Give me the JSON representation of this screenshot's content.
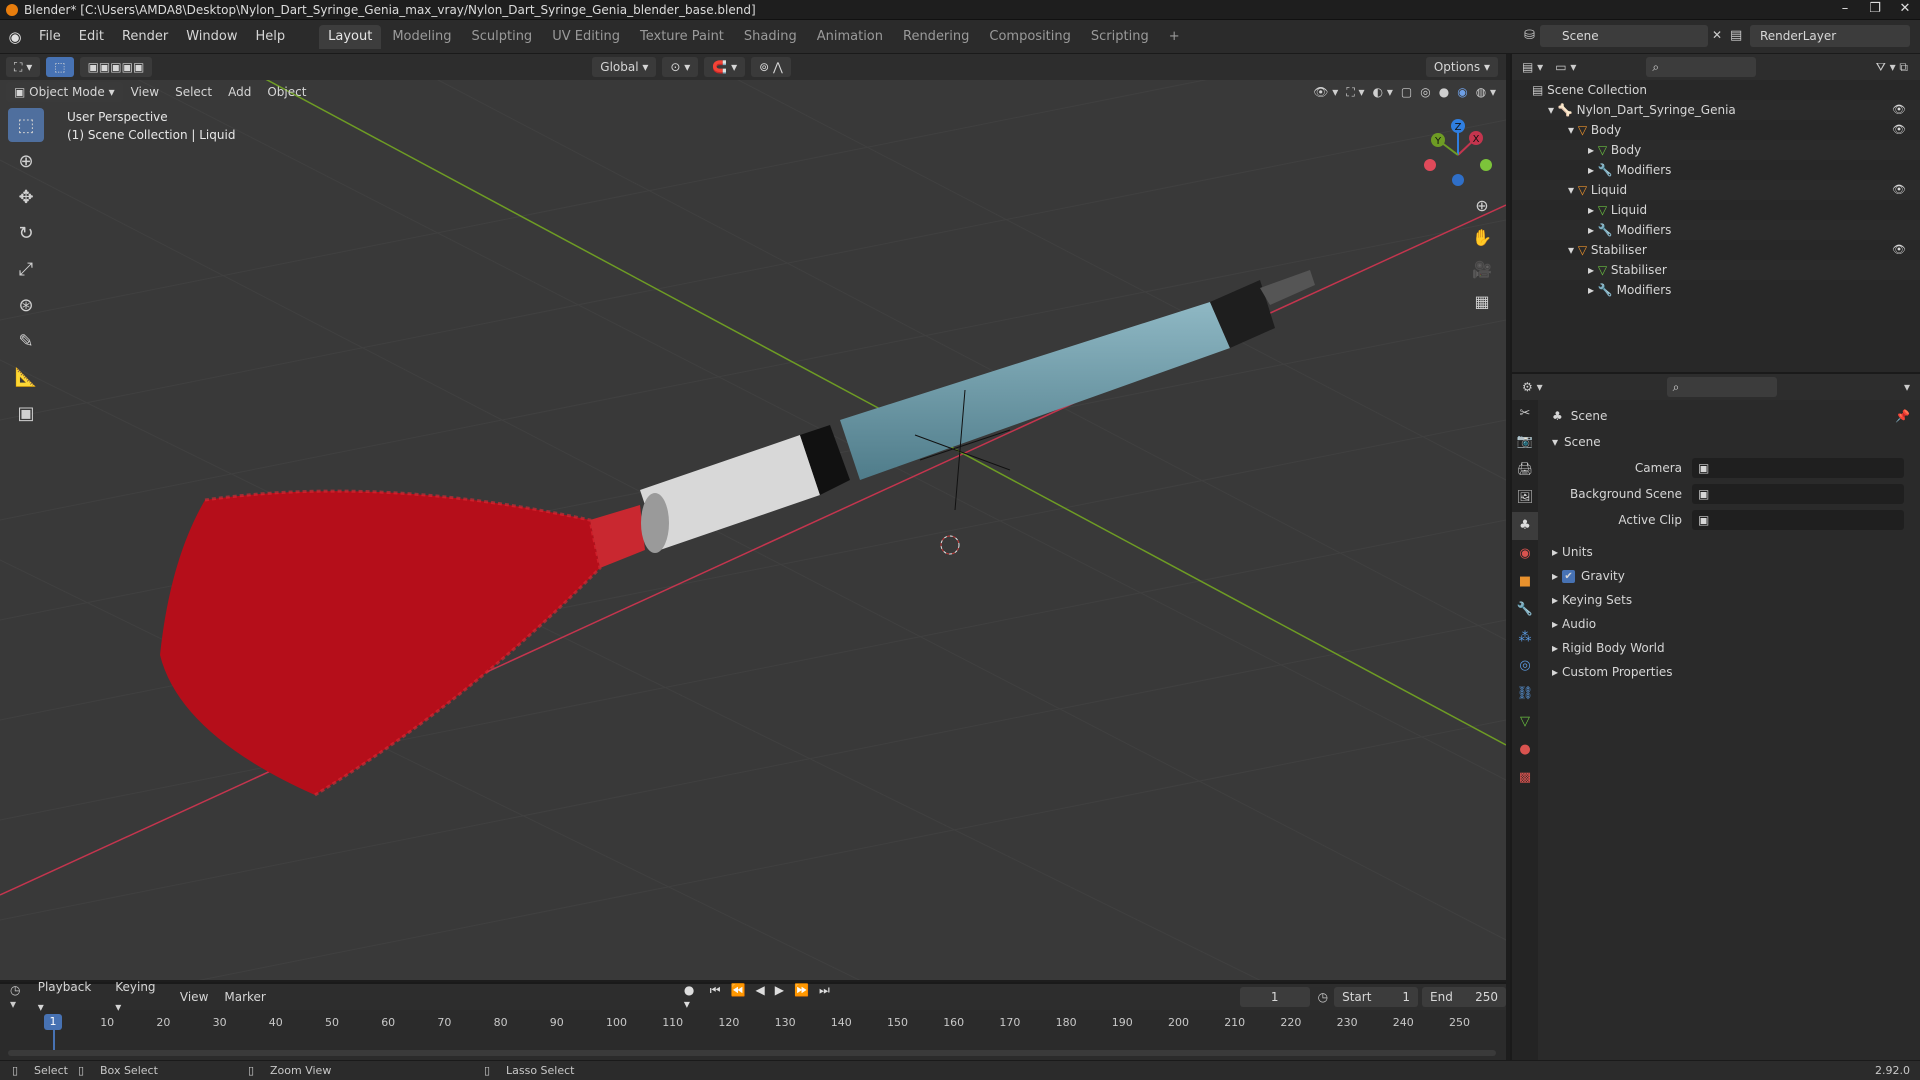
{
  "title_bar": {
    "text": "Blender* [C:\\Users\\AMDA8\\Desktop\\Nylon_Dart_Syringe_Genia_max_vray/Nylon_Dart_Syringe_Genia_blender_base.blend]"
  },
  "menu": [
    "File",
    "Edit",
    "Render",
    "Window",
    "Help"
  ],
  "workspaces": [
    "Layout",
    "Modeling",
    "Sculpting",
    "UV Editing",
    "Texture Paint",
    "Shading",
    "Animation",
    "Rendering",
    "Compositing",
    "Scripting"
  ],
  "active_workspace": "Layout",
  "scene_name": "Scene",
  "render_layer": "RenderLayer",
  "viewport_header": {
    "orientation": "Global",
    "options": "Options",
    "mode": "Object Mode",
    "menus": [
      "View",
      "Select",
      "Add",
      "Object"
    ]
  },
  "viewport_info": {
    "line1": "User Perspective",
    "line2": "(1) Scene Collection | Liquid"
  },
  "gizmo": {
    "x": "X",
    "y": "Y",
    "z": "Z"
  },
  "outliner": {
    "root": "Scene Collection",
    "rows": [
      {
        "label": "Nylon_Dart_Syringe_Genia",
        "level": 1,
        "type": "armature"
      },
      {
        "label": "Body",
        "level": 2,
        "type": "object"
      },
      {
        "label": "Body",
        "level": 3,
        "type": "mesh"
      },
      {
        "label": "Modifiers",
        "level": 3,
        "type": "modifier"
      },
      {
        "label": "Liquid",
        "level": 2,
        "type": "object"
      },
      {
        "label": "Liquid",
        "level": 3,
        "type": "mesh"
      },
      {
        "label": "Modifiers",
        "level": 3,
        "type": "modifier"
      },
      {
        "label": "Stabiliser",
        "level": 2,
        "type": "object"
      },
      {
        "label": "Stabiliser",
        "level": 3,
        "type": "mesh"
      },
      {
        "label": "Modifiers",
        "level": 3,
        "type": "modifier"
      }
    ]
  },
  "properties": {
    "context": "Scene",
    "panel": "Scene",
    "fields": [
      {
        "label": "Camera"
      },
      {
        "label": "Background Scene"
      },
      {
        "label": "Active Clip"
      }
    ],
    "sections": [
      "Units",
      "Gravity",
      "Keying Sets",
      "Audio",
      "Rigid Body World",
      "Custom Properties"
    ]
  },
  "timeline": {
    "menus": [
      "Playback",
      "Keying",
      "View",
      "Marker"
    ],
    "current_frame": "1",
    "start_label": "Start",
    "start": "1",
    "end_label": "End",
    "end": "250",
    "ticks": [
      "10",
      "20",
      "30",
      "40",
      "50",
      "60",
      "70",
      "80",
      "90",
      "100",
      "110",
      "120",
      "130",
      "140",
      "150",
      "160",
      "170",
      "180",
      "190",
      "200",
      "210",
      "220",
      "230",
      "240",
      "250"
    ]
  },
  "statusbar": {
    "select": "Select",
    "box_select": "Box Select",
    "zoom_view": "Zoom View",
    "lasso_select": "Lasso Select",
    "version": "2.92.0"
  },
  "colors": {
    "accent": "#4772b3",
    "x_axis": "#c4354e",
    "y_axis": "#6e9c24",
    "z_axis": "#2f7ee0",
    "dart": "#c0101c"
  }
}
